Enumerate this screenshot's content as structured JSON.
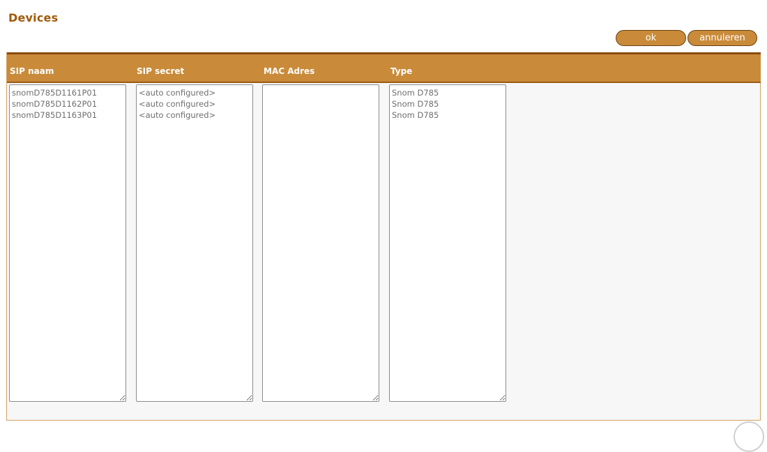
{
  "page": {
    "title": "Devices"
  },
  "actions": {
    "ok_label": "ok",
    "cancel_label": "annuleren"
  },
  "table": {
    "columns": [
      "SIP naam",
      "SIP secret",
      "MAC Adres",
      "Type"
    ],
    "sip_naam": "snomD785D1161P01\nsnomD785D1162P01\nsnomD785D1163P01",
    "sip_secret": "<auto configured>\n<auto configured>\n<auto configured>",
    "mac_adres": "",
    "type": "Snom D785\nSnom D785\nSnom D785"
  },
  "colors": {
    "title": "#a05a0a",
    "header_bg": "#c98b3a",
    "header_border": "#8a4a0c",
    "button_bg": "#c98b3a"
  }
}
